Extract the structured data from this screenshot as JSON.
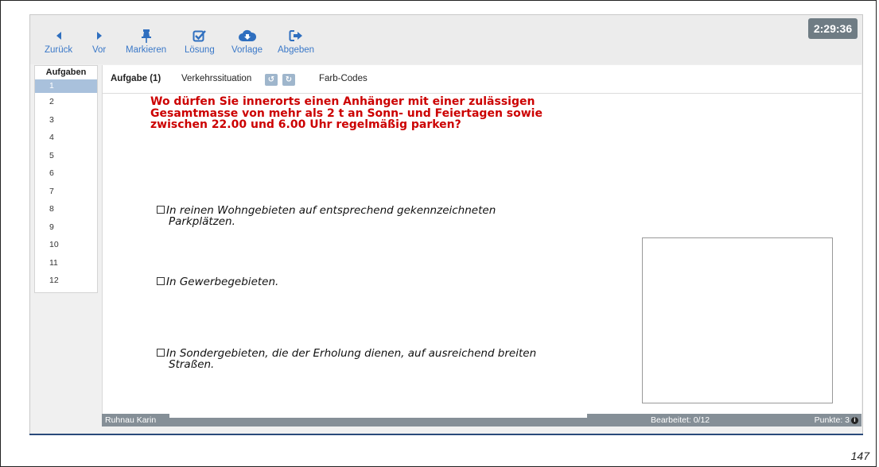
{
  "toolbar": {
    "back_label": "Zurück",
    "forward_label": "Vor",
    "mark_label": "Markieren",
    "solution_label": "Lösung",
    "template_label": "Vorlage",
    "submit_label": "Abgeben",
    "timer": "2:29:36",
    "accent_color": "#3a78c8"
  },
  "sidebar": {
    "title": "Aufgaben",
    "items": [
      "1",
      "2",
      "3",
      "4",
      "5",
      "6",
      "7",
      "8",
      "9",
      "10",
      "11",
      "12"
    ],
    "active_index": 0
  },
  "tabs": {
    "task_label": "Aufgabe (1)",
    "traffic_label": "Verkehrssituation",
    "colors_label": "Farb-Codes",
    "undo_icon": "undo-icon",
    "redo_icon": "redo-icon"
  },
  "question": {
    "lines": [
      "Wo dürfen Sie innerorts einen Anhänger mit einer zulässigen",
      "Gesamtmasse von mehr als 2 t an Sonn- und Feiertagen sowie",
      "zwischen 22.00 und 6.00 Uhr regelmäßig parken?"
    ],
    "color": "#cc0000"
  },
  "answers": [
    {
      "line1": "In reinen Wohngebieten auf entsprechend gekennzeichneten",
      "line2": "Parkplätzen.",
      "checked": false
    },
    {
      "line1": "In Gewerbegebieten.",
      "line2": "",
      "checked": false
    },
    {
      "line1": "In Sondergebieten, die der Erholung dienen, auf ausreichend breiten",
      "line2": "Straßen.",
      "checked": false
    }
  ],
  "footer": {
    "user": "Ruhnau Karin",
    "progress": "Bearbeitet: 0/12",
    "points": "Punkte: 3",
    "info_icon": "info-icon"
  },
  "page_number": "147"
}
